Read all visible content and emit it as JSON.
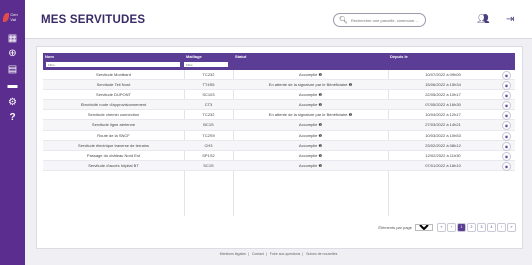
{
  "app": {
    "logo_text": "Cen Val"
  },
  "sidebar": {
    "items": [
      {
        "icon": "grid-icon"
      },
      {
        "icon": "plus-circle-icon"
      },
      {
        "icon": "document-icon"
      },
      {
        "icon": "folder-icon"
      },
      {
        "icon": "gear-icon"
      },
      {
        "icon": "help-icon"
      }
    ]
  },
  "header": {
    "title": "MES SERVITUDES",
    "search_placeholder": "Rechercher une parcelle, commune…",
    "user_icon": "user-group-icon",
    "logout_icon": "logout-icon"
  },
  "table": {
    "columns": {
      "nom": "Nom",
      "mailage": "Maillage",
      "statut": "Statut",
      "depuis": "Depuis le"
    },
    "filters": {
      "nom_placeholder": "Filtre",
      "mailage_placeholder": "Filtre"
    },
    "rows": [
      {
        "nom": "Servitude Montbard",
        "mailage": "TC232",
        "statut": "Accomplie ❶",
        "depuis": "10/07/2022 à 09h00"
      },
      {
        "nom": "Servitude Teil Nord",
        "mailage": "TT4S5",
        "statut": "En attente de la signature par le Bénéficiaire ❶",
        "depuis": "15/06/2022 à 15h34"
      },
      {
        "nom": "Servitude DUPONT",
        "mailage": "SC103",
        "statut": "Accomplie ❶",
        "depuis": "22/05/2022 à 10h17"
      },
      {
        "nom": "Electricité route d'approvisionnement",
        "mailage": "CT3",
        "statut": "Accomplie ❶",
        "depuis": "07/05/2022 à 16h30"
      },
      {
        "nom": "Servitude chemin connection",
        "mailage": "TC232",
        "statut": "En attente de la signature par le Bénéficiaire ❶",
        "depuis": "10/04/2022 à 12h17"
      },
      {
        "nom": "Servitude ligne aérienne",
        "mailage": "BC1S",
        "statut": "Accomplie ❶",
        "depuis": "27/03/2022 à 14h21"
      },
      {
        "nom": "Route de la SNCF",
        "mailage": "TC2S9",
        "statut": "Accomplie ❶",
        "depuis": "10/03/2022 à 10h53"
      },
      {
        "nom": "Servitude électrique traverse de terrains",
        "mailage": "CH3",
        "statut": "Accomplie ❶",
        "depuis": "23/02/2022 à 08h12"
      },
      {
        "nom": "Passage du château Nord Est",
        "mailage": "SP1S2",
        "statut": "Accomplie ❶",
        "depuis": "12/02/2022 à 11h30"
      },
      {
        "nom": "Servitude d'accès hôpital BT",
        "mailage": "SC1S",
        "statut": "Accomplie ❶",
        "depuis": "07/01/2022 à 16h10"
      }
    ]
  },
  "pagination": {
    "label": "Éléments par page",
    "per_page": "10",
    "buttons": [
      "«",
      "‹",
      "1",
      "2",
      "3",
      "4",
      "›",
      "»"
    ],
    "active": "1"
  },
  "footer": {
    "links": [
      "Mentions légales",
      "Contact",
      "Foire aux questions",
      "Suivez de nouvelles"
    ]
  },
  "colors": {
    "brand": "#5b2d8e",
    "header_bar": "#5b3d96",
    "title": "#3a2b67"
  }
}
